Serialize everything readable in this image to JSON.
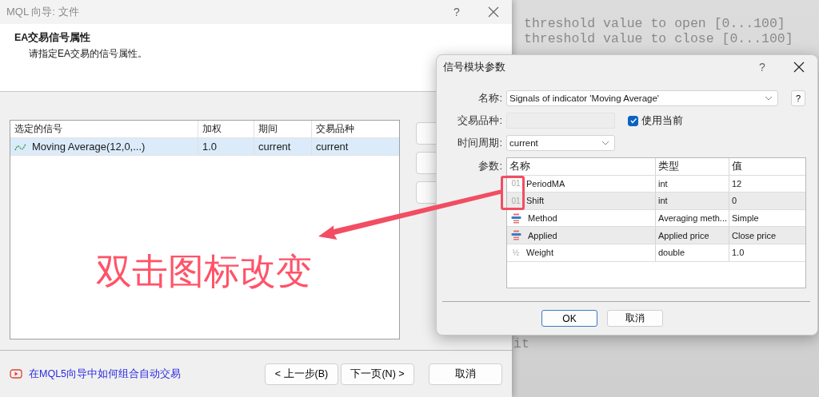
{
  "background_code": {
    "lines": [
      "threshold value to open [0...100]",
      "threshold value to close [0...100]"
    ],
    "fragment": "it"
  },
  "wizard": {
    "title": "MQL 向导: 文件",
    "help": "?",
    "header": {
      "title": "EA交易信号属性",
      "subtitle": "请指定EA交易的信号属性。"
    },
    "signals_table": {
      "columns": [
        "选定的信号",
        "加权",
        "期间",
        "交易品种"
      ],
      "rows": [
        {
          "cells": [
            "Moving Average(12,0,...)",
            "1.0",
            "current",
            "current"
          ],
          "selected": true
        }
      ]
    },
    "footer": {
      "link": "在MQL5向导中如何组合自动交易",
      "buttons": [
        "< 上一步(B)",
        "下一页(N) >",
        "取消"
      ]
    }
  },
  "dialog": {
    "title": "信号模块参数",
    "help": "?",
    "name_label": "名称:",
    "name_value": "Signals of indicator 'Moving Average'",
    "name_help": "?",
    "symbol_label": "交易品种:",
    "use_current": {
      "label": "使用当前",
      "checked": true
    },
    "timeframe_label": "时间周期:",
    "timeframe_value": "current",
    "params_label": "参数:",
    "params": {
      "columns": [
        "名称",
        "类型",
        "值"
      ],
      "rows": [
        {
          "kind": "glyph",
          "glyph": "01",
          "name": "PeriodMA",
          "type": "int",
          "value": "12"
        },
        {
          "kind": "glyph",
          "glyph": "01",
          "name": "Shift",
          "type": "int",
          "value": "0"
        },
        {
          "kind": "enum",
          "name": "Method",
          "type": "Averaging meth...",
          "value": "Simple"
        },
        {
          "kind": "enum",
          "name": "Applied",
          "type": "Applied price",
          "value": "Close price"
        },
        {
          "kind": "glyph",
          "glyph": "½",
          "name": "Weight",
          "type": "double",
          "value": "1.0"
        }
      ]
    },
    "buttons": [
      "OK",
      "取消"
    ]
  },
  "annotation": {
    "text": "双击图标改变"
  }
}
